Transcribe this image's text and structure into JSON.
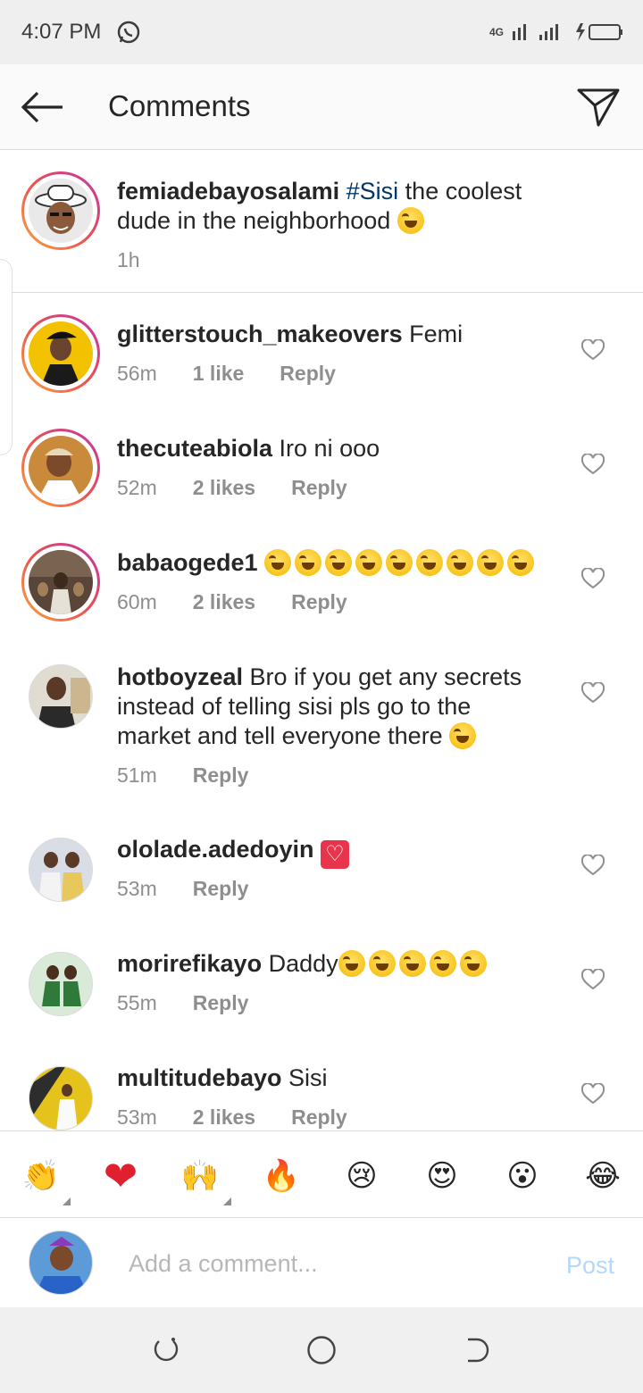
{
  "status_bar": {
    "time": "4:07 PM",
    "network": "4G"
  },
  "app_bar": {
    "title": "Comments"
  },
  "caption": {
    "username": "femiadebayosalami",
    "hashtag": "#Sisi",
    "text_1": " the coolest",
    "text_2": "dude in the neighborhood",
    "time": "1h"
  },
  "comments": [
    {
      "username": "glitterstouch_makeovers",
      "text": " Femi",
      "time": "56m",
      "likes": "1 like",
      "reply": "Reply"
    },
    {
      "username": "thecuteabiola",
      "text": " Iro ni ooo",
      "time": "52m",
      "likes": "2 likes",
      "reply": "Reply"
    },
    {
      "username": "babaogede1",
      "text": "",
      "time": "60m",
      "likes": "2 likes",
      "reply": "Reply"
    },
    {
      "username": "hotboyzeal",
      "line_1": " Bro if you get any secrets",
      "line_2": "instead of telling sisi pls go to the",
      "line_3": "market and tell everyone there",
      "time": "51m",
      "reply": "Reply"
    },
    {
      "username": "ololade.adedoyin",
      "text": "",
      "time": "53m",
      "reply": "Reply"
    },
    {
      "username": "morirefikayo",
      "text": " Daddy",
      "time": "55m",
      "reply": "Reply"
    },
    {
      "username": "multitudebayo",
      "text": " Sisi",
      "time": "53m",
      "likes": "2 likes",
      "reply": "Reply"
    }
  ],
  "quick_reactions": [
    "👏",
    "❤",
    "🙌",
    "🔥",
    "😢",
    "😍",
    "😮",
    "😂"
  ],
  "composer": {
    "placeholder": "Add a comment...",
    "post_label": "Post"
  },
  "colors": {
    "hashtag": "#00376b",
    "post_disabled": "#b3d8f9",
    "meta": "#8e8e8e"
  }
}
